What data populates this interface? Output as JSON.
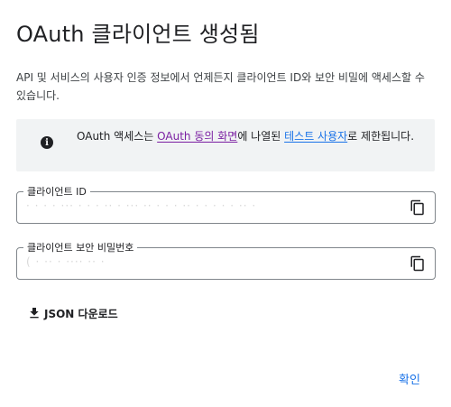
{
  "dialog": {
    "title": "OAuth 클라이언트 생성됨",
    "description": "API 및 서비스의 사용자 인증 정보에서 언제든지 클라이언트 ID와 보안 비밀에 액세스할 수 있습니다."
  },
  "info": {
    "icon": "info-icon",
    "text_before": "OAuth 액세스는 ",
    "consent_link": "OAuth 동의 화면",
    "text_middle": "에 나열된 ",
    "test_users_link": "테스트 사용자",
    "text_after": "로 제한됩니다."
  },
  "client_id": {
    "label": "클라이언트 ID",
    "value": "·    ·          ·  ·  ··· ·   ·  ·  ·· · ··· ·· ·   ·  ·  ·· ·     ·  ·  ·  ·  ·· ·",
    "copy_icon": "copy-icon"
  },
  "client_secret": {
    "label": "클라이언트 보안 비밀번호",
    "value": "( ·  ··         ·  ···· ·· ·",
    "copy_icon": "copy-icon"
  },
  "actions": {
    "download_label": "JSON 다운로드",
    "download_icon": "download-icon",
    "confirm_label": "확인"
  },
  "colors": {
    "accent": "#1a73e8",
    "visited_link": "#7b1fa2",
    "info_background": "#f1f3f4"
  }
}
